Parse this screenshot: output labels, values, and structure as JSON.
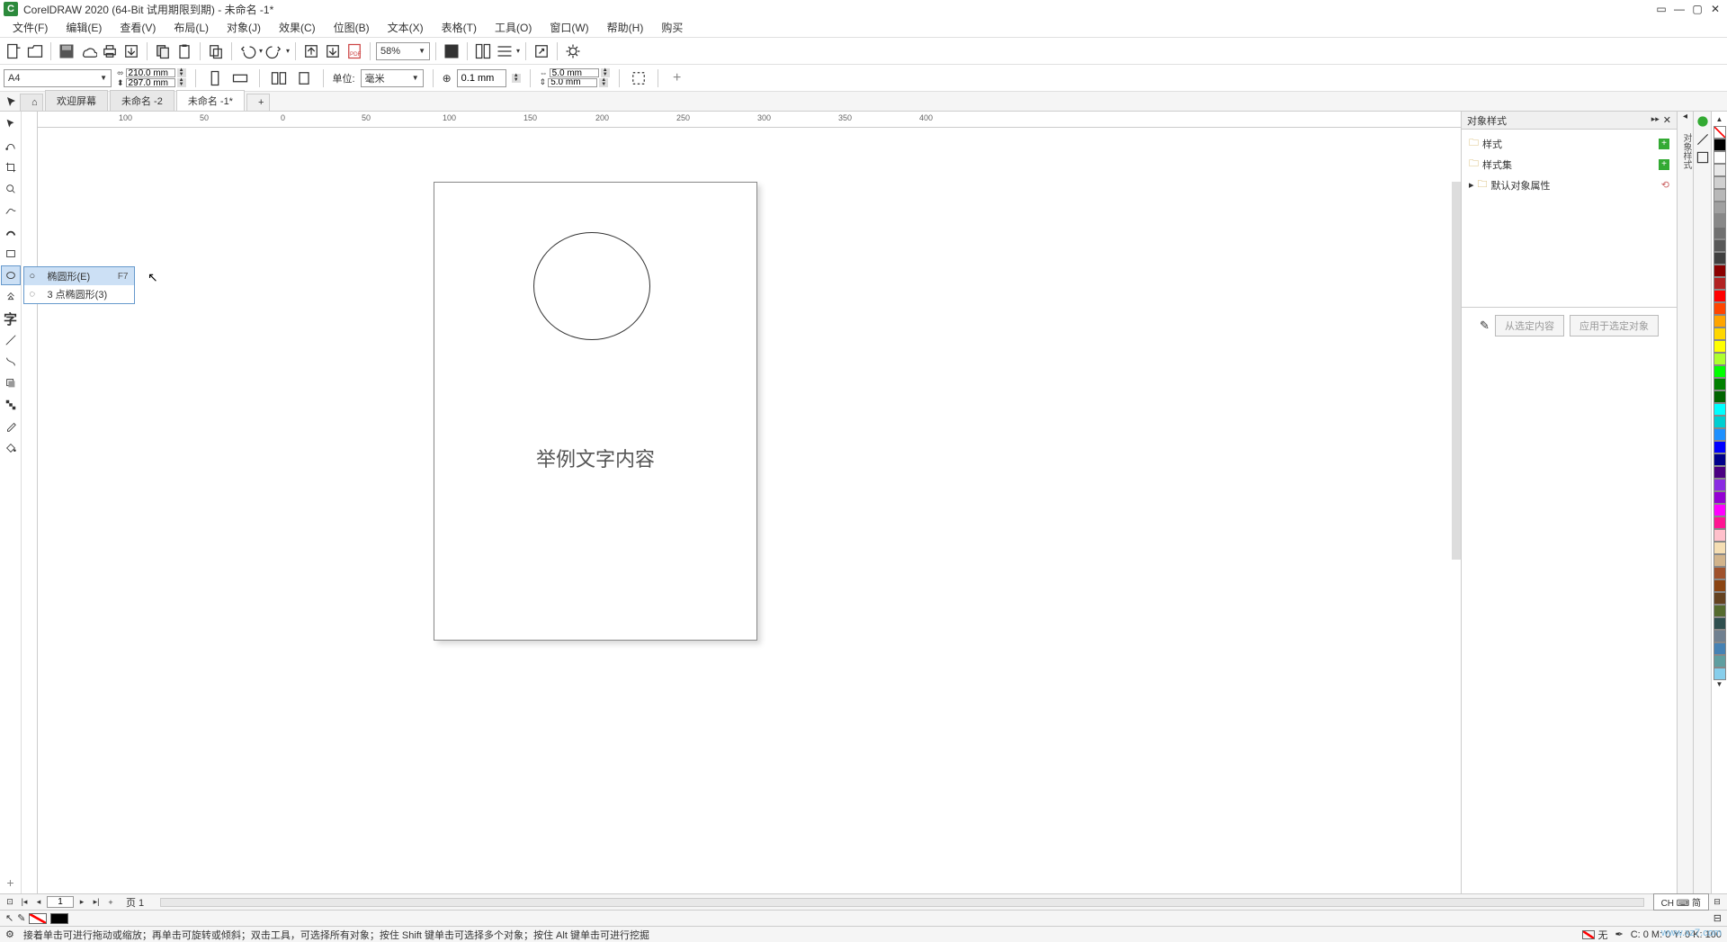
{
  "title": "CorelDRAW 2020 (64-Bit 试用期限到期) - 未命名 -1*",
  "menu": [
    "文件(F)",
    "编辑(E)",
    "查看(V)",
    "布局(L)",
    "对象(J)",
    "效果(C)",
    "位图(B)",
    "文本(X)",
    "表格(T)",
    "工具(O)",
    "窗口(W)",
    "帮助(H)",
    "购买"
  ],
  "zoom": "58%",
  "paper": {
    "preset": "A4",
    "width": "210.0 mm",
    "height": "297.0 mm"
  },
  "units_label": "单位:",
  "units_value": "毫米",
  "nudge": "0.1 mm",
  "dup": {
    "x": "5.0 mm",
    "y": "5.0 mm"
  },
  "tabs": {
    "home_icon": "⌂",
    "items": [
      "欢迎屏幕",
      "未命名 -2",
      "未命名 -1*"
    ],
    "active_index": 2,
    "add": "+"
  },
  "ruler_ticks": [
    "100",
    "50",
    "0",
    "50",
    "100",
    "150",
    "200",
    "250",
    "300",
    "350",
    "400"
  ],
  "flyout": {
    "items": [
      {
        "icon": "○",
        "label": "椭圆形(E)",
        "shortcut": "F7"
      },
      {
        "icon": "◌",
        "label": "3 点椭圆形(3)",
        "shortcut": ""
      }
    ],
    "selected": 0
  },
  "canvas_text": "举例文字内容",
  "right_panel": {
    "title": "对象样式",
    "items": [
      "样式",
      "样式集",
      "默认对象属性"
    ],
    "btn1": "从选定内容",
    "btn2": "应用于选定对象",
    "strip_label": "对象样式"
  },
  "pagenav": {
    "page_label": "页 1"
  },
  "ime": "CH ⌨ 简",
  "propbar": {},
  "status": {
    "hint": "接着单击可进行拖动或缩放；再单击可旋转或倾斜；双击工具，可选择所有对象；按住 Shift 键单击可选择多个对象；按住 Alt 键单击可进行挖掘",
    "fill_label": "无",
    "coords": "C: 0 M: 0 Y: 0 K: 100"
  },
  "watermark": "www.xz7.com",
  "colors": [
    "#000000",
    "#FFFFFF",
    "#e8e8e8",
    "#d0d0d0",
    "#b8b8b8",
    "#a0a0a0",
    "#888888",
    "#707070",
    "#585858",
    "#404040",
    "#8B0000",
    "#B22222",
    "#FF0000",
    "#FF4500",
    "#FFA500",
    "#FFD700",
    "#FFFF00",
    "#ADFF2F",
    "#00FF00",
    "#008000",
    "#006400",
    "#00FFFF",
    "#00CED1",
    "#1E90FF",
    "#0000FF",
    "#00008B",
    "#4B0082",
    "#8A2BE2",
    "#9400D3",
    "#FF00FF",
    "#FF1493",
    "#FFC0CB",
    "#F5DEB3",
    "#D2B48C",
    "#A0522D",
    "#8B4513",
    "#654321",
    "#556B2F",
    "#2F4F4F",
    "#708090",
    "#4682B4",
    "#5F9EA0",
    "#87CEEB"
  ]
}
